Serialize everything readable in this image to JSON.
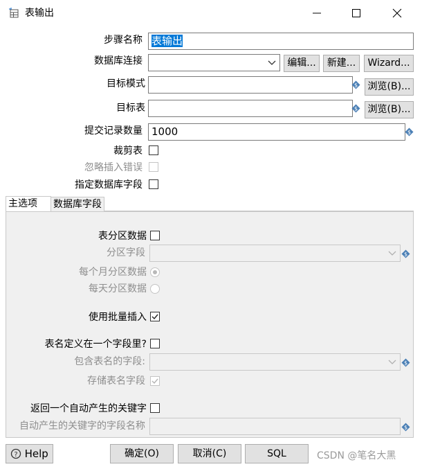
{
  "window": {
    "title": "表输出",
    "controls": {
      "minimize": "minimize-icon",
      "maximize": "maximize-icon",
      "close": "close-icon"
    }
  },
  "form": {
    "step_name": {
      "label": "步骤名称",
      "value": "表输出"
    },
    "db_connection": {
      "label": "数据库连接",
      "value": "",
      "edit": "编辑...",
      "new": "新建...",
      "wizard": "Wizard..."
    },
    "target_schema": {
      "label": "目标模式",
      "value": "",
      "browse": "浏览(B)..."
    },
    "target_table": {
      "label": "目标表",
      "value": "",
      "browse": "浏览(B)..."
    },
    "commit_size": {
      "label": "提交记录数量",
      "value": "1000"
    },
    "truncate": {
      "label": "裁剪表",
      "checked": false
    },
    "ignore_errors": {
      "label": "忽略插入错误",
      "checked": false,
      "disabled": true
    },
    "specify_fields": {
      "label": "指定数据库字段",
      "checked": false
    }
  },
  "tabs": [
    {
      "label": "主选项",
      "active": true
    },
    {
      "label": "数据库字段",
      "active": false
    }
  ],
  "main_tab": {
    "partition_data": {
      "label": "表分区数据",
      "checked": false
    },
    "partition_field": {
      "label": "分区字段",
      "value": ""
    },
    "monthly": {
      "label": "每个月分区数据",
      "selected": true
    },
    "daily": {
      "label": "每天分区数据",
      "selected": false
    },
    "batch_insert": {
      "label": "使用批量插入",
      "checked": true
    },
    "table_in_field": {
      "label": "表名定义在一个字段里?",
      "checked": false
    },
    "table_name_field": {
      "label": "包含表名的字段:",
      "value": ""
    },
    "store_table_name": {
      "label": "存储表名字段",
      "checked": true
    },
    "return_key": {
      "label": "返回一个自动产生的关键字",
      "checked": false
    },
    "key_field_name": {
      "label": "自动产生的关键字的字段名称",
      "value": ""
    }
  },
  "footer": {
    "help": "Help",
    "ok": "确定(O)",
    "cancel": "取消(C)",
    "sql": "SQL",
    "watermark": "CSDN @笔名大黑"
  },
  "colors": {
    "selection": "#0078d7",
    "panel_bg": "#f0f0f0",
    "button_bg": "#e1e1e1"
  }
}
